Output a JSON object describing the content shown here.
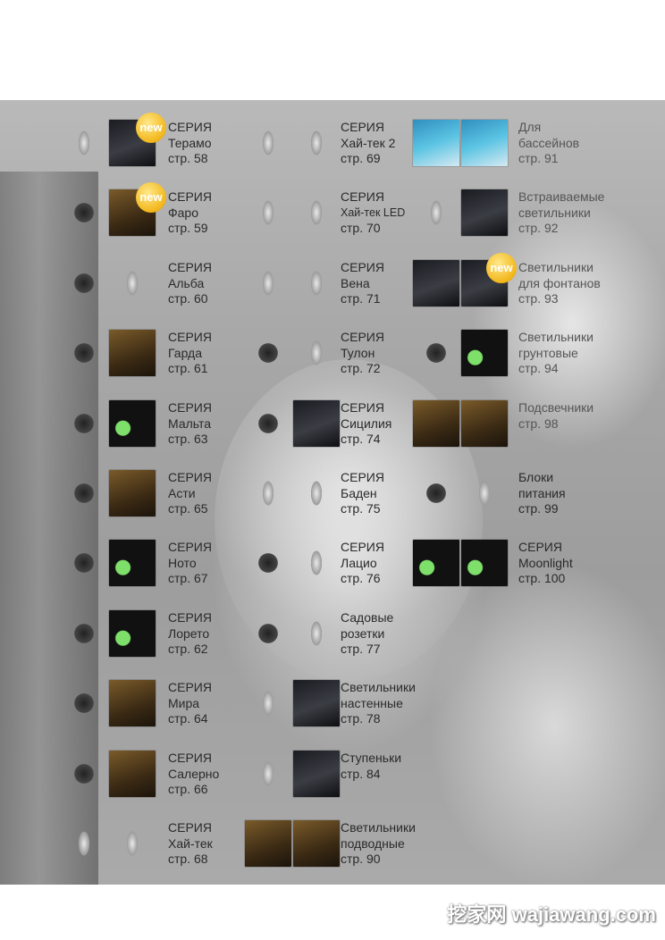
{
  "new_badge": "new",
  "watermark": "挖家网 wajiawang.com",
  "columns": [
    [
      {
        "lines": [
          "СЕРИЯ",
          "Терамо",
          "стр. 58"
        ],
        "new": true
      },
      {
        "lines": [
          "СЕРИЯ",
          "Фаро",
          "стр. 59"
        ],
        "new": true
      },
      {
        "lines": [
          "СЕРИЯ",
          "Альба",
          "стр. 60"
        ]
      },
      {
        "lines": [
          "СЕРИЯ",
          "Гарда",
          "стр. 61"
        ]
      },
      {
        "lines": [
          "СЕРИЯ",
          "Мальта",
          "стр. 63"
        ]
      },
      {
        "lines": [
          "СЕРИЯ",
          "Асти",
          "стр. 65"
        ]
      },
      {
        "lines": [
          "СЕРИЯ",
          "Ното",
          "стр. 67"
        ]
      },
      {
        "lines": [
          "СЕРИЯ",
          "Лорето",
          "стр. 62"
        ]
      },
      {
        "lines": [
          "СЕРИЯ",
          "Мира",
          "стр. 64"
        ]
      },
      {
        "lines": [
          "СЕРИЯ",
          "Салерно",
          "стр. 66"
        ]
      },
      {
        "lines": [
          "СЕРИЯ",
          "Хай-тек",
          "стр. 68"
        ]
      }
    ],
    [
      {
        "lines": [
          "СЕРИЯ",
          "Хай-тек 2",
          "стр. 69"
        ]
      },
      {
        "lines": [
          "СЕРИЯ",
          "Хай-тек LED",
          "стр.  70"
        ]
      },
      {
        "lines": [
          "СЕРИЯ",
          "Вена",
          "стр. 71"
        ]
      },
      {
        "lines": [
          "СЕРИЯ",
          "Тулон",
          "стр. 72"
        ]
      },
      {
        "lines": [
          "СЕРИЯ",
          "Сицилия",
          "стр. 74"
        ]
      },
      {
        "lines": [
          "СЕРИЯ",
          "Баден",
          "стр. 75"
        ]
      },
      {
        "lines": [
          "СЕРИЯ",
          "Лацио",
          "стр. 76"
        ]
      },
      {
        "lines": [
          "Садовые",
          "розетки",
          "стр. 77"
        ]
      },
      {
        "lines": [
          "Светильники",
          "настенные",
          "стр. 78"
        ]
      },
      {
        "lines": [
          "Ступеньки",
          "стр. 84"
        ]
      },
      {
        "lines": [
          "Светильники",
          "подводные",
          "стр. 90"
        ]
      }
    ],
    [
      {
        "lines": [
          "Для",
          "бассейнов",
          "стр. 91"
        ]
      },
      {
        "lines": [
          "Встраиваемые",
          "светильники",
          "стр. 92"
        ]
      },
      {
        "lines": [
          "Светильники",
          "для фонтанов",
          "стр. 93"
        ],
        "new": true
      },
      {
        "lines": [
          "Светильники",
          "грунтовые",
          "стр. 94"
        ]
      },
      {
        "lines": [
          "Подсвечники",
          "стр. 98"
        ]
      },
      {
        "lines": [
          "Блоки",
          "питания",
          "стр. 99"
        ]
      },
      {
        "lines": [
          "СЕРИЯ",
          "Moonlight",
          "стр. 100"
        ]
      }
    ]
  ]
}
